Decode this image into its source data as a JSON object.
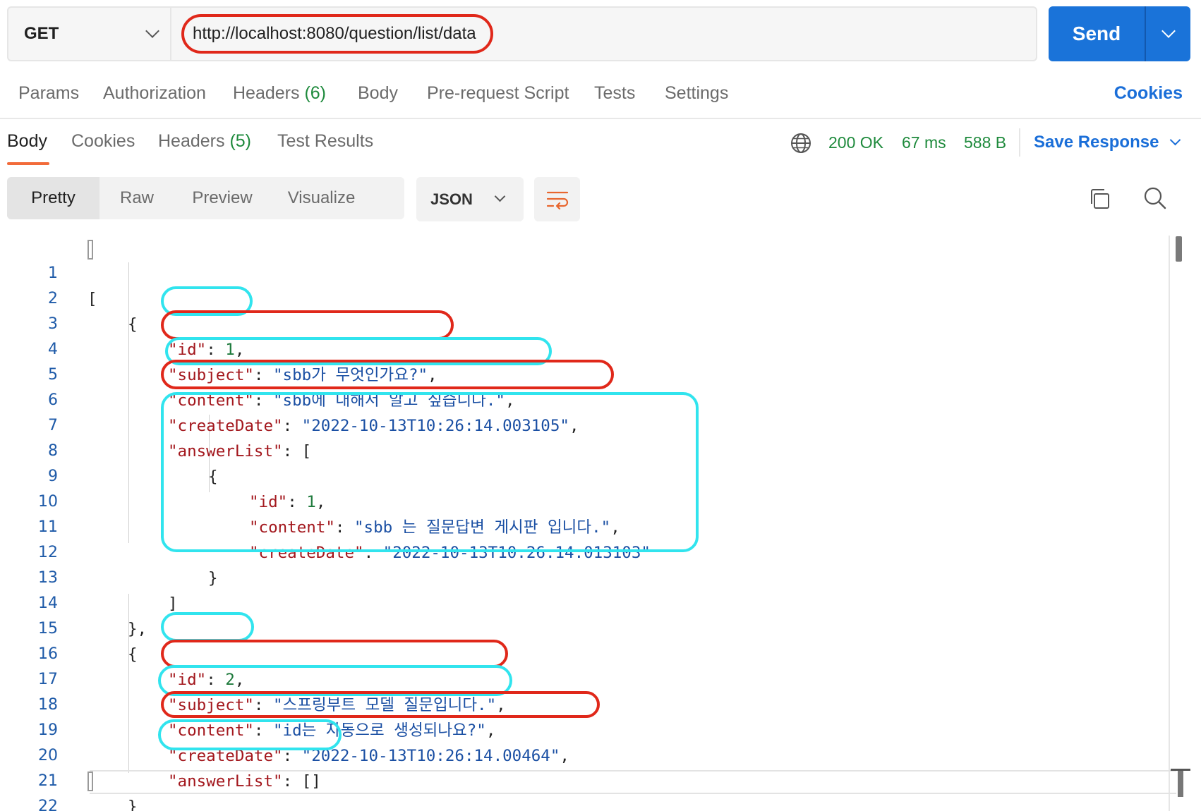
{
  "request": {
    "method": "GET",
    "url": "http://localhost:8080/question/list/data",
    "send_label": "Send"
  },
  "request_tabs": {
    "params": "Params",
    "authorization": "Authorization",
    "headers": "Headers",
    "headers_count": "(6)",
    "body": "Body",
    "pre_request": "Pre-request Script",
    "tests": "Tests",
    "settings": "Settings",
    "cookies": "Cookies"
  },
  "response_tabs": {
    "body": "Body",
    "cookies": "Cookies",
    "headers": "Headers",
    "headers_count": "(5)",
    "test_results": "Test Results"
  },
  "status": {
    "code": "200 OK",
    "time": "67 ms",
    "size": "588 B",
    "save_response": "Save Response"
  },
  "format": {
    "pretty": "Pretty",
    "raw": "Raw",
    "preview": "Preview",
    "visualize": "Visualize",
    "language": "JSON"
  },
  "code": {
    "line_numbers": [
      "1",
      "2",
      "3",
      "4",
      "5",
      "6",
      "7",
      "8",
      "9",
      "10",
      "11",
      "12",
      "13",
      "14",
      "15",
      "16",
      "17",
      "18",
      "19",
      "20",
      "21",
      "22"
    ],
    "open_bracket": "[",
    "close_bracket": "]",
    "open_brace": "{",
    "close_brace": "}",
    "close_brace_comma": "},",
    "key_id": "\"id\"",
    "key_subject": "\"subject\"",
    "key_content": "\"content\"",
    "key_createDate": "\"createDate\"",
    "key_answerList": "\"answerList\"",
    "q1": {
      "id": "1",
      "subject": "\"sbb가 무엇인가요?\"",
      "content": "\"sbb에 대해서 알고 싶습니다.\"",
      "createDate": "\"2022-10-13T10:26:14.003105\"",
      "answer": {
        "id": "1",
        "content": "\"sbb 는 질문답변 게시판 입니다.\"",
        "createDate": "\"2022-10-13T10:26:14.013103\""
      }
    },
    "q2": {
      "id": "2",
      "subject": "\"스프링부트 모델 질문입니다.\"",
      "content": "\"id는 자동으로 생성되나요?\"",
      "createDate": "\"2022-10-13T10:26:14.00464\"",
      "answerList": "[]"
    }
  },
  "icons": {
    "method_chevron": "chevron-down-icon",
    "send_chevron": "chevron-down-icon",
    "network": "globe-icon",
    "wrap": "wrap-lines-icon",
    "copy": "copy-icon",
    "search": "search-icon"
  },
  "colors": {
    "accent": "#1a73d9",
    "status_ok": "#1e8a3c",
    "active_tab": "#f26b3a",
    "annotation_red": "#e0281a",
    "annotation_cyan": "#31e4ee"
  }
}
